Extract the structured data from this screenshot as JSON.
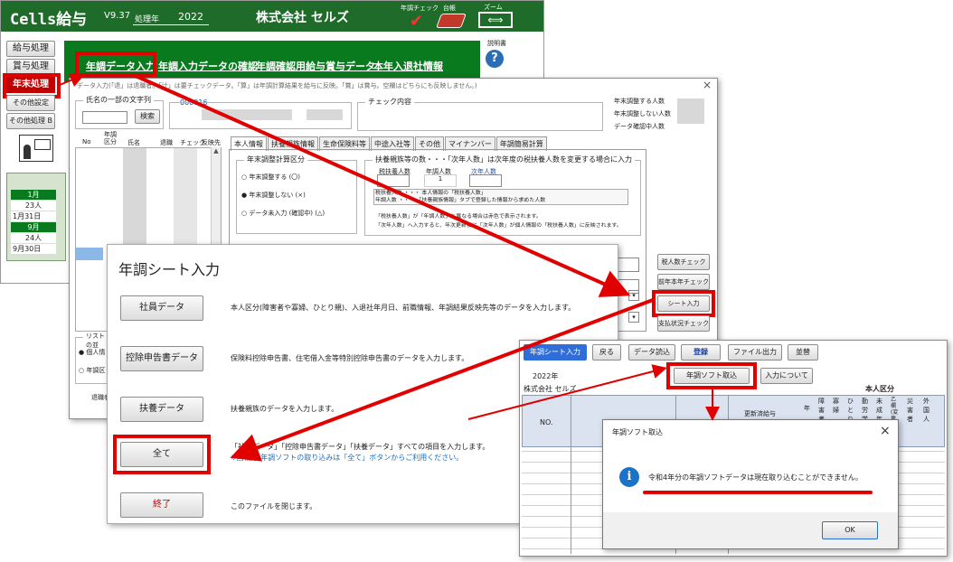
{
  "main": {
    "app_title": "Cells給与",
    "version": "V9.37",
    "year_label": "処理年",
    "year": "2022",
    "company": "株式会社 セルズ",
    "right_icons": {
      "check": "年調チェック",
      "ledger": "台帳",
      "zoom": "ズーム"
    },
    "help": "説明書",
    "side_buttons": [
      "給与処理",
      "賞与処理",
      "年末処理",
      "その他設定",
      "その他処理 B"
    ],
    "menu_links": [
      "年調データ入力",
      "年調入力データの確認",
      "年調確認用給与賞与データ",
      "本年入退社情報"
    ],
    "calendar": {
      "rows": [
        {
          "label": "1月",
          "header": true
        },
        {
          "label": "23人"
        },
        {
          "label": "1月31日",
          "extra": "2"
        },
        {
          "label": "9月",
          "header": true
        },
        {
          "label": "24人"
        },
        {
          "label": "9月30日",
          "extra": "10"
        }
      ]
    }
  },
  "input_window": {
    "header_text": "データ入力(「退」は退職者。「汁」は要チェックデータ。「算」は年調計算結果を給与に反映。「賞」は賞与。空欄はどちらにも反映しません。)",
    "name_search_label": "氏名の一部の文字列",
    "search_button": "検索",
    "employee_id": "000016",
    "check_content": "チェック内容",
    "right_counts": [
      "年末調整する人数",
      "年末調整しない人数",
      "データ確認中人数"
    ],
    "list_headers": [
      "No",
      "年調区分",
      "氏名",
      "退職",
      "チェック",
      "反映先"
    ],
    "tabs": [
      "本人情報",
      "扶養親族情報",
      "生命保険料等",
      "中途入社等",
      "その他",
      "マイナンバー",
      "年調簡易計算"
    ],
    "calc_group": "年末調整計算区分",
    "radio_options": [
      "年末調整する (〇)",
      "年末調整しない (×)",
      "データ未入力 (確認中) (△)"
    ],
    "dependents_group": "扶養親族等の数・・・「次年人数」は次年度の税扶養人数を変更する場合に入力",
    "dependents_cols": [
      "税扶養人数",
      "年調人数",
      "次年人数"
    ],
    "dependents_value": "1",
    "notes": [
      "税扶養人数 ・・・ 本人情報の「税扶養人数」",
      "年調人数 ・・・ 「扶養親族情報」タブで登録した情報から求めた人数",
      "「税扶養人数」が「年調人数」と異なる場合は赤色で表示されます。",
      "「次年人数」へ入力すると、年次更新後に「次年人数」が個人情報の「税扶養人数」に反映されます。"
    ],
    "side_buttons": [
      "税人数チェック",
      "前年本年チェック",
      "シート入力",
      "支払状況チェック"
    ],
    "list_group": "リストの並",
    "list_radio": [
      "個人情",
      "年調区"
    ],
    "bottom_label": "退職者"
  },
  "nencho_dialog": {
    "title": "年調シート入力",
    "rows": [
      {
        "button": "社員データ",
        "desc": "本人区分(障害者や寡婦、ひとり親)、入退社年月日、前職情報、年調結果反映先等のデータを入力します。"
      },
      {
        "button": "控除申告書データ",
        "desc": "保険料控除申告書、住宅借入金等特別控除申告書のデータを入力します。"
      },
      {
        "button": "扶養データ",
        "desc": "扶養親族のデータを入力します。"
      },
      {
        "button": "全て",
        "desc": "「社員データ」「控除申告書データ」「扶養データ」すべての項目を入力します。",
        "note": "※国税庁 年調ソフトの取り込みは「全て」ボタンからご利用ください。"
      },
      {
        "button": "終了",
        "desc": "このファイルを閉じます。"
      }
    ]
  },
  "sheet_window": {
    "toolbar": [
      "年調シート入力",
      "戻る",
      "データ読込",
      "登録",
      "ファイル出力",
      "並替"
    ],
    "year": "2022年",
    "company": "株式会社 セルズ",
    "import_button": "年調ソフト取込",
    "about_button": "入力について",
    "section": "本人区分",
    "col_no": "NO.",
    "col_update": "更新済給与",
    "cols_vertical": [
      "年",
      "障害者",
      "寡婦",
      "ひとり",
      "勤労学",
      "未成年",
      "乙欄(変更不可)",
      "災害者",
      "外国人"
    ]
  },
  "msgbox": {
    "title": "年調ソフト取込",
    "message": "令和4年分の年調ソフトデータは現在取り込むことができません。",
    "ok": "OK",
    "close": "×"
  }
}
